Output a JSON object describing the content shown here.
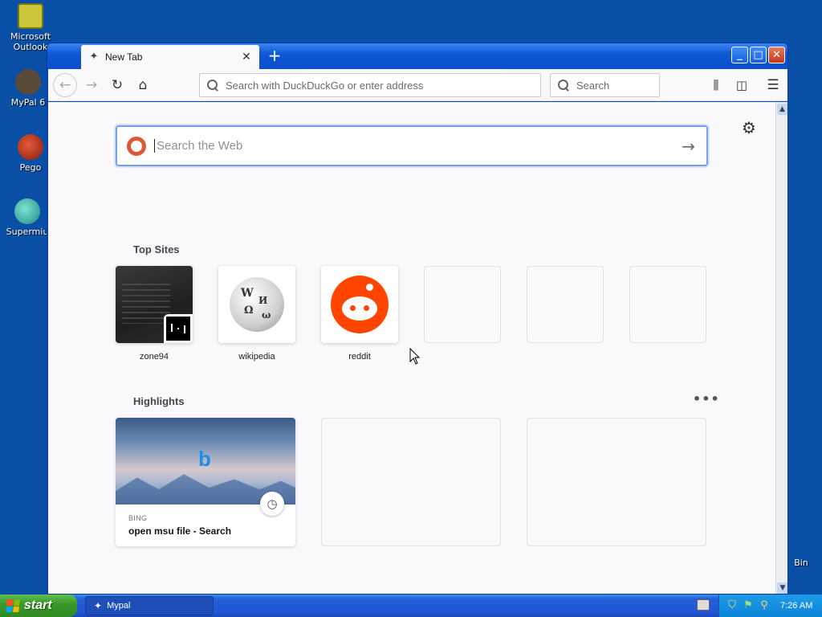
{
  "desktop": {
    "icons": [
      {
        "label": "Microsoft Outlook"
      },
      {
        "label": "MyPal 6"
      },
      {
        "label": "Pego"
      },
      {
        "label": "Supermiu"
      },
      {
        "label": "Bin"
      }
    ]
  },
  "browser": {
    "tab": {
      "title": "New Tab",
      "close": "✕"
    },
    "new_tab": "+",
    "window_controls": {
      "minimize": "_",
      "maximize": "□",
      "close": "✕"
    },
    "toolbar": {
      "url_placeholder": "Search with DuckDuckGo or enter address",
      "search_placeholder": "Search"
    },
    "newtab_page": {
      "web_search_placeholder": "Search the Web",
      "top_sites_heading": "Top Sites",
      "top_sites": [
        {
          "name": "zone94"
        },
        {
          "name": "wikipedia"
        },
        {
          "name": "reddit"
        }
      ],
      "highlights_heading": "Highlights",
      "highlights": [
        {
          "source": "BING",
          "title": "open msu file - Search"
        }
      ]
    }
  },
  "taskbar": {
    "start_label": "start",
    "task_label": "Mypal",
    "clock": "7:26 AM"
  },
  "colors": {
    "desktop_bg": "#0a4fa6",
    "accent": "#74a0e6",
    "reddit": "#ff4500",
    "ddg": "#de5833"
  }
}
